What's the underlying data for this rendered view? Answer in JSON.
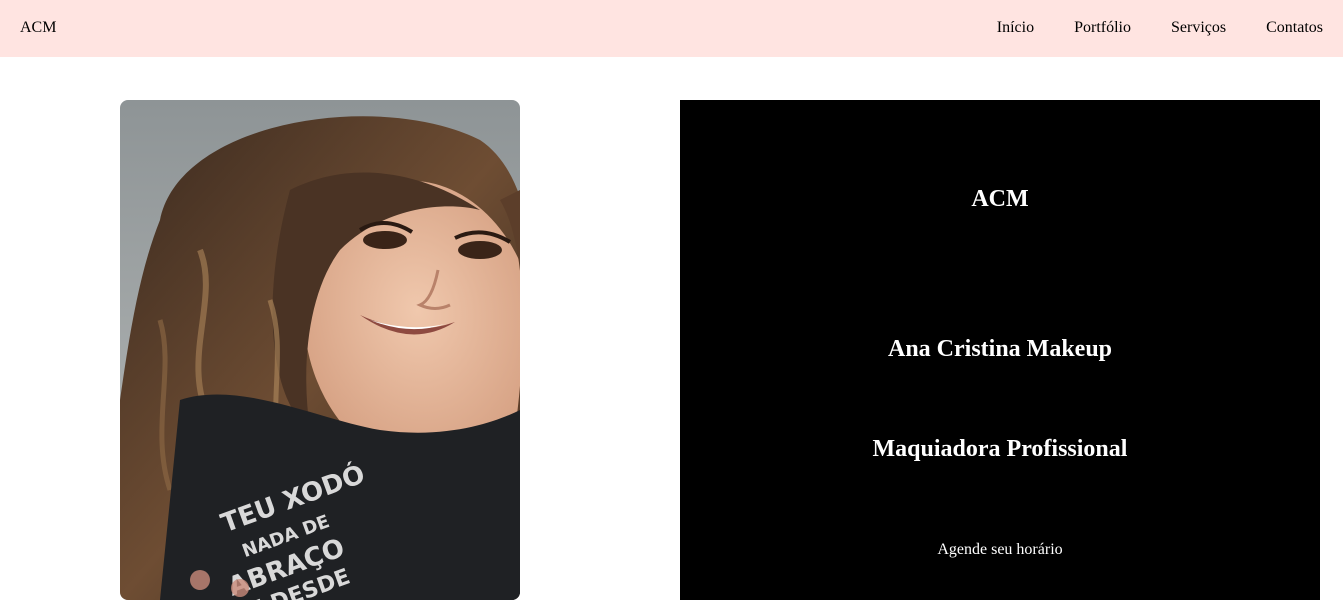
{
  "navbar": {
    "brand": "ACM",
    "links": [
      "Início",
      "Portfólio",
      "Serviços",
      "Contatos"
    ]
  },
  "hero": {
    "title": "ACM",
    "name": "Ana Cristina Makeup",
    "subtitle": "Maquiadora Profissional",
    "cta": "Agende seu horário"
  },
  "photo": {
    "shirt_text": "TEU XODÓ NADA DE ABRAÇO QUE DESDE QUIS ME L"
  },
  "colors": {
    "navbar_bg": "#ffe4e1",
    "hero_bg": "#000000",
    "hero_text": "#ffffff"
  }
}
